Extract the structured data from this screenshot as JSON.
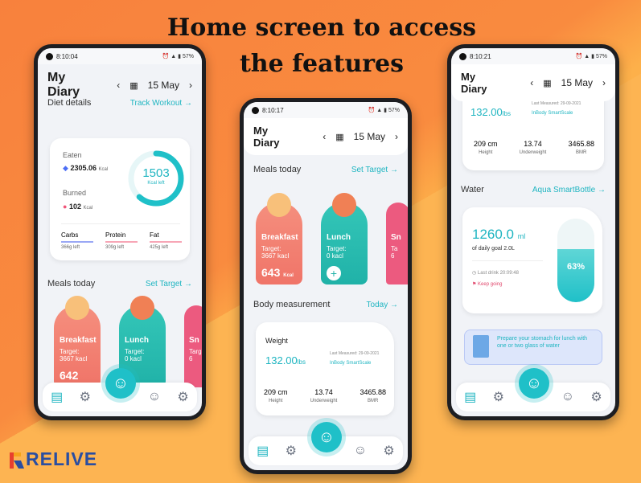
{
  "headline": {
    "line1": "Home screen to access",
    "line2": "the features"
  },
  "logo": {
    "text_r": "R",
    "text_rest": "ELIVE"
  },
  "phone1": {
    "status": {
      "time": "8:10:04",
      "battery": "57%"
    },
    "title_l1": "My",
    "title_l2": "Diary",
    "date": "15 May",
    "diet_label": "Diet details",
    "track_link": "Track Workout →",
    "eaten_label": "Eaten",
    "eaten_val": "2305.06",
    "eaten_unit": "Kcal",
    "burned_label": "Burned",
    "burned_val": "102",
    "burned_unit": "Kcal",
    "ring_val": "1503",
    "ring_label": "Kcal left",
    "macros": [
      {
        "name": "Carbs",
        "left": "366g left"
      },
      {
        "name": "Protein",
        "left": "309g left"
      },
      {
        "name": "Fat",
        "left": "425g left"
      }
    ],
    "meals_label": "Meals today",
    "set_target": "Set Target →",
    "meals": [
      {
        "name": "Breakfast",
        "target_label": "Target:",
        "target": "3667 kacl",
        "cal": "642"
      },
      {
        "name": "Lunch",
        "target_label": "Target:",
        "target": "0 kacl"
      },
      {
        "name": "Sn",
        "target_label": "Target:",
        "target": "6"
      }
    ]
  },
  "phone2": {
    "status": {
      "time": "8:10:17",
      "battery": "57%"
    },
    "title_l1": "My",
    "title_l2": "Diary",
    "date": "15 May",
    "meals_label": "Meals today",
    "set_target": "Set Target →",
    "meals": [
      {
        "name": "Breakfast",
        "target_label": "Target:",
        "target": "3667 kacl",
        "cal": "643",
        "unit": "Kcal"
      },
      {
        "name": "Lunch",
        "target_label": "Target:",
        "target": "0 kacl",
        "add": "+"
      },
      {
        "name": "Sn",
        "target_label": "Ta",
        "target": "6"
      }
    ],
    "body_label": "Body measurement",
    "today_link": "Today →",
    "weight_label": "Weight",
    "weight_val": "132.00",
    "weight_unit": "lbs",
    "last_measured": "Last Measured: 29-09-2021",
    "source": "InBody SmartScale",
    "stats": [
      {
        "v": "209 cm",
        "l": "Height"
      },
      {
        "v": "13.74",
        "l": "Underweight"
      },
      {
        "v": "3465.88",
        "l": "BMR"
      }
    ]
  },
  "phone3": {
    "status": {
      "time": "8:10:21",
      "battery": "57%"
    },
    "title_l1": "My",
    "title_l2": "Diary",
    "date": "15 May",
    "last_measured": "Last Measured: 29-09-2021",
    "weight_val": "132.00",
    "weight_unit": "lbs",
    "source": "InBody SmartScale",
    "stats": [
      {
        "v": "209 cm",
        "l": "Height"
      },
      {
        "v": "13.74",
        "l": "Underweight"
      },
      {
        "v": "3465.88",
        "l": "BMR"
      }
    ],
    "water_label": "Water",
    "water_link": "Aqua SmartBottle →",
    "water_val": "1260.0",
    "water_unit": "ml",
    "water_goal": "of daily goal 2.0L",
    "pct": "63%",
    "last_drink": "Last drink 20:09:48",
    "keep": "Keep going",
    "tip": "Prepare your stomach for lunch with one or two glass of water"
  }
}
